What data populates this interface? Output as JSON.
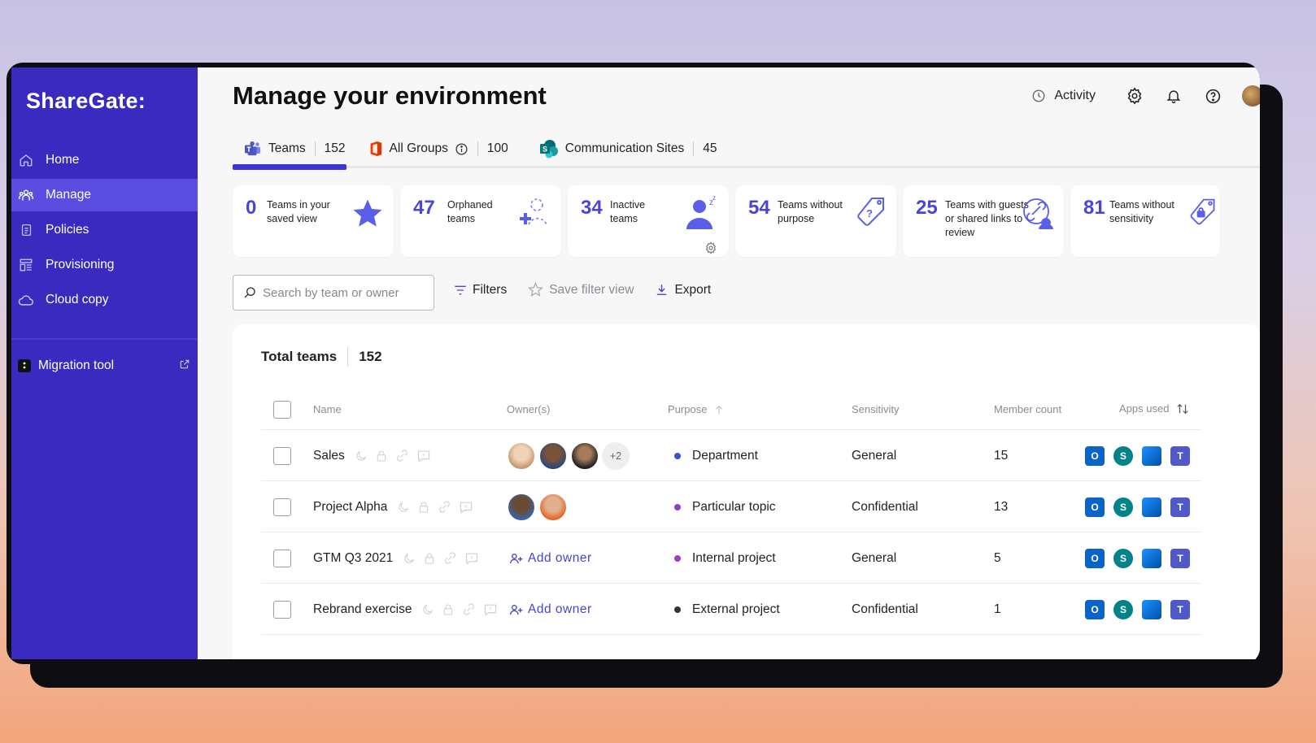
{
  "sidebar": {
    "logo": "ShareGate:",
    "items": [
      {
        "label": "Home",
        "icon": "home-icon"
      },
      {
        "label": "Manage",
        "icon": "manage-icon",
        "active": true
      },
      {
        "label": "Policies",
        "icon": "policies-icon"
      },
      {
        "label": "Provisioning",
        "icon": "provisioning-icon"
      },
      {
        "label": "Cloud copy",
        "icon": "cloud-icon"
      }
    ],
    "migration_label": "Migration tool"
  },
  "header": {
    "title": "Manage your environment",
    "activity_label": "Activity"
  },
  "tabs": [
    {
      "label": "Teams",
      "count": "152",
      "icon": "teams-icon"
    },
    {
      "label": "All Groups",
      "count": "100",
      "icon": "office-icon"
    },
    {
      "label": "Communication Sites",
      "count": "45",
      "icon": "sharepoint-icon"
    }
  ],
  "cards": [
    {
      "num": "0",
      "label": "Teams in your saved view",
      "icon": "star-icon"
    },
    {
      "num": "47",
      "label": "Orphaned teams",
      "icon": "orphaned-icon"
    },
    {
      "num": "34",
      "label": "Inactive teams",
      "icon": "sleeping-user-icon"
    },
    {
      "num": "54",
      "label": "Teams without purpose",
      "icon": "question-tag-icon"
    },
    {
      "num": "25",
      "label": "Teams with guests or shared links to review",
      "icon": "link-review-icon"
    },
    {
      "num": "81",
      "label": "Teams without sensitivity",
      "icon": "lock-tag-icon"
    }
  ],
  "search": {
    "placeholder": "Search by team or owner"
  },
  "toolbar": {
    "filters_label": "Filters",
    "save_filter_label": "Save filter view",
    "export_label": "Export"
  },
  "table": {
    "total_label": "Total teams",
    "total_count": "152",
    "columns": {
      "name": "Name",
      "owners": "Owner(s)",
      "purpose": "Purpose",
      "sensitivity": "Sensitivity",
      "member_count": "Member count",
      "apps_used": "Apps used"
    },
    "rows": [
      {
        "name": "Sales",
        "owners_extra": "+2",
        "purpose": "Department",
        "purpose_color": "#3c4fd8",
        "sensitivity": "General",
        "members": "15"
      },
      {
        "name": "Project Alpha",
        "purpose": "Particular topic",
        "purpose_color": "#8a3fd1",
        "sensitivity": "Confidential",
        "members": "13"
      },
      {
        "name": "GTM Q3 2021",
        "add_owner": "Add owner",
        "purpose": "Internal project",
        "purpose_color": "#9b3fc7",
        "sensitivity": "General",
        "members": "5"
      },
      {
        "name": "Rebrand exercise",
        "add_owner": "Add owner",
        "purpose": "External project",
        "purpose_color": "#333333",
        "sensitivity": "Confidential",
        "members": "1"
      }
    ]
  },
  "colors": {
    "sidebar": "#3a2ac0",
    "accent": "#3f34d6",
    "card_number": "#4b44d6"
  }
}
